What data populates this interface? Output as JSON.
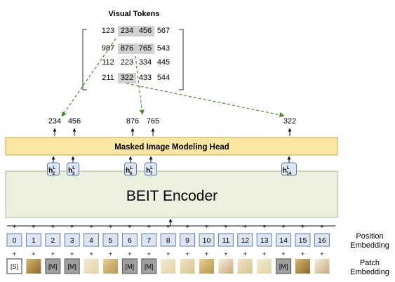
{
  "visual_tokens": {
    "title": "Visual Tokens",
    "grid": [
      [
        "123",
        "234",
        "456",
        "567"
      ],
      [
        "987",
        "876",
        "765",
        "543"
      ],
      [
        "112",
        "223",
        "334",
        "445"
      ],
      [
        "211",
        "322",
        "433",
        "544"
      ]
    ],
    "highlighted": [
      [
        0,
        1
      ],
      [
        0,
        2
      ],
      [
        1,
        1
      ],
      [
        1,
        2
      ],
      [
        3,
        1
      ]
    ]
  },
  "predicted_tokens": [
    "234",
    "456",
    "876",
    "765",
    "322"
  ],
  "mim_head": {
    "label": "Masked Image Modeling Head",
    "color": "#fbe6a2"
  },
  "hidden_states": [
    {
      "base": "h",
      "sup": "L",
      "sub": "2"
    },
    {
      "base": "h",
      "sup": "L",
      "sub": "3"
    },
    {
      "base": "h",
      "sup": "L",
      "sub": "6"
    },
    {
      "base": "h",
      "sup": "L",
      "sub": "7"
    },
    {
      "base": "h",
      "sup": "L",
      "sub": "14"
    }
  ],
  "encoder": {
    "label": "BEIT Encoder",
    "color": "#ebf1de"
  },
  "positions": [
    "0",
    "1",
    "2",
    "3",
    "4",
    "5",
    "6",
    "7",
    "8",
    "9",
    "10",
    "11",
    "12",
    "13",
    "14",
    "15",
    "16"
  ],
  "position_label": "Position Embedding",
  "plus_symbol": "+",
  "patches": [
    "[S]",
    "img",
    "[M]",
    "[M]",
    "img",
    "img",
    "[M]",
    "[M]",
    "img",
    "img",
    "img",
    "img",
    "img",
    "img",
    "[M]",
    "img",
    "img"
  ],
  "patch_label": "Patch Embedding",
  "colors": {
    "position_box": "#dce6f2",
    "position_border": "#5b7fa6",
    "arrow_green": "#4e8a2e",
    "token_highlight": "#d0d0d0",
    "mask_box": "#a0a0a0"
  }
}
